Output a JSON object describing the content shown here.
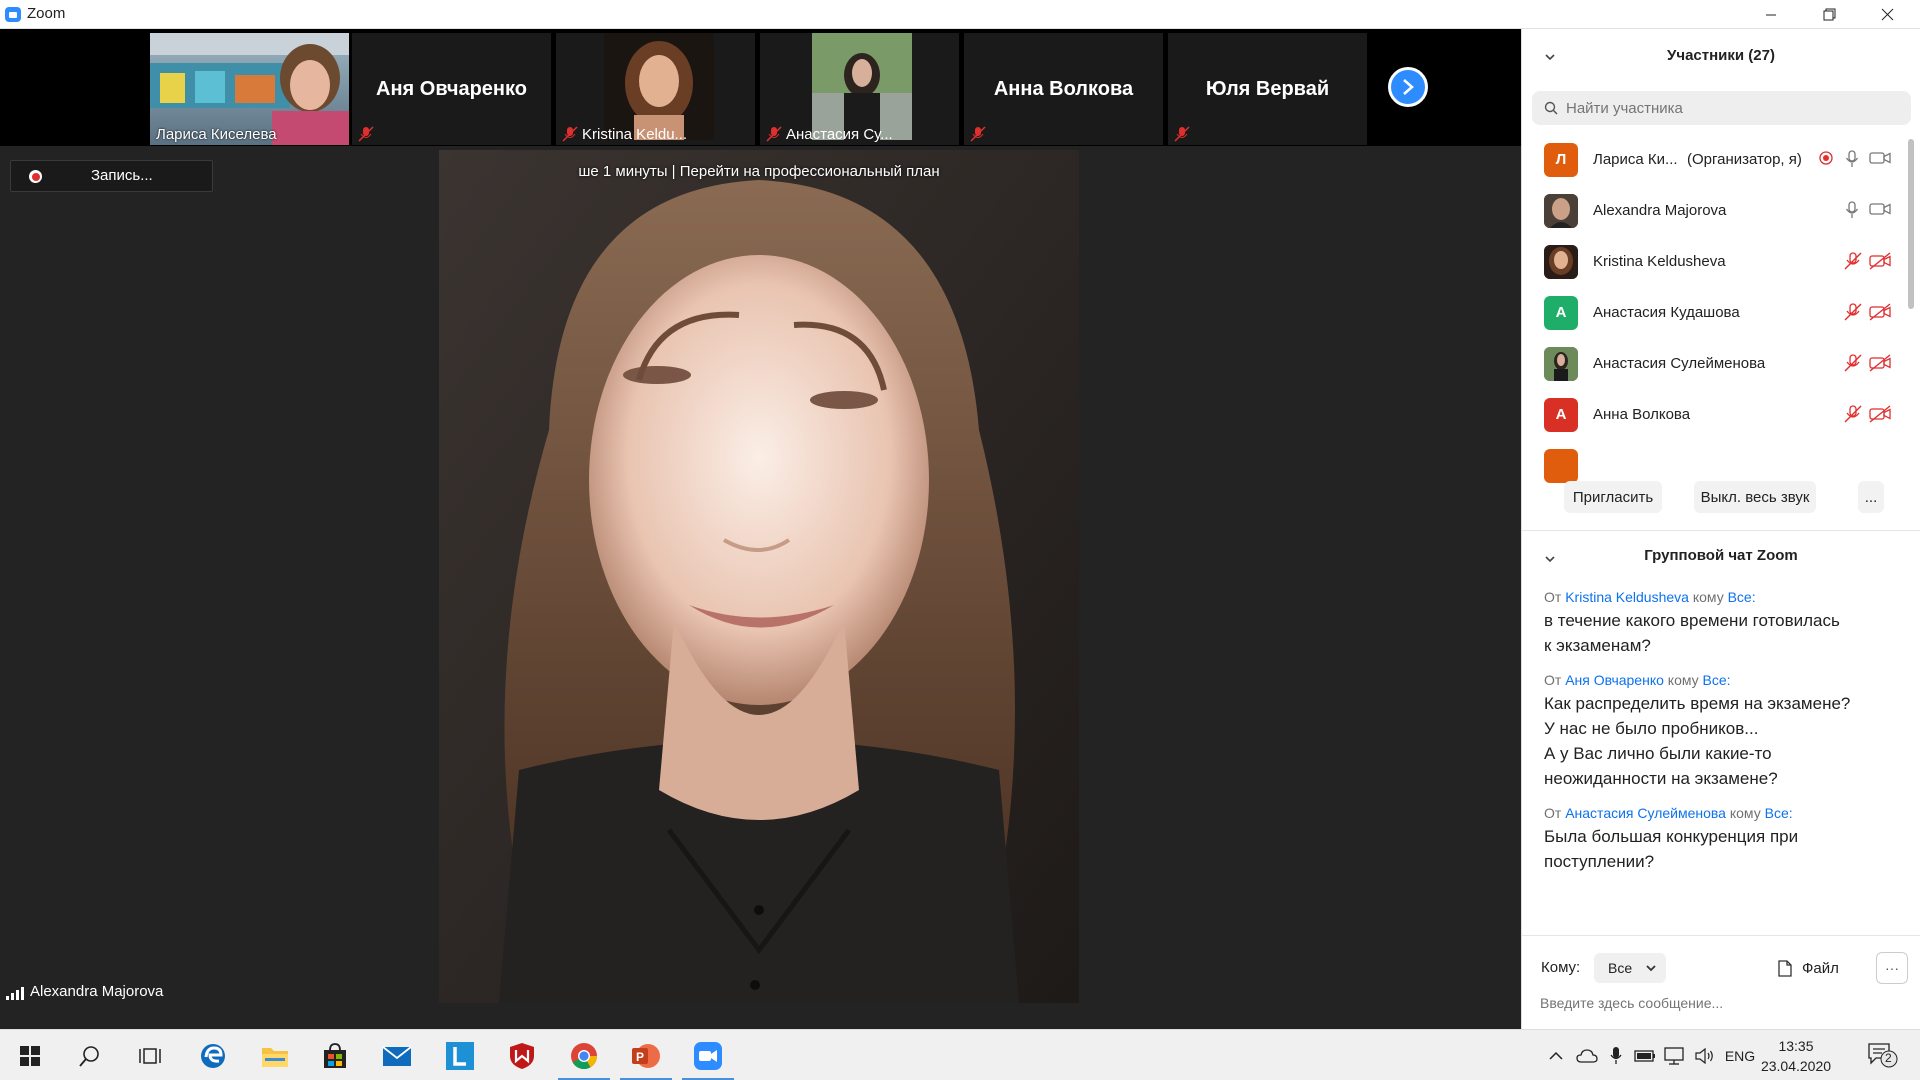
{
  "window": {
    "title": "Zoom"
  },
  "strip": {
    "tiles": [
      {
        "label": "Лариса Киселева"
      },
      {
        "name": "Аня Овчаренко"
      },
      {
        "label": "Kristina Keldu..."
      },
      {
        "label": "Анастасия Су..."
      },
      {
        "name": "Анна Волкова"
      },
      {
        "name": "Юля Вервай"
      }
    ]
  },
  "recording": {
    "label": "Запись..."
  },
  "main_video": {
    "banner": "ше 1 минуты | Перейти на профессиональный план",
    "speaker": "Alexandra Majorova"
  },
  "participants": {
    "title": "Участники (27)",
    "search_placeholder": "Найти участника",
    "list": [
      {
        "initial": "Л",
        "name": "Лариса Ки...",
        "role": "(Организатор, я)",
        "color": "#e05d0e"
      },
      {
        "initial": "",
        "name": "Alexandra Majorova",
        "role": "",
        "color": "#4a4038"
      },
      {
        "initial": "",
        "name": "Kristina Keldusheva",
        "role": "",
        "color": "#8a5a44"
      },
      {
        "initial": "А",
        "name": "Анастасия Кудашова",
        "role": "",
        "color": "#1fae6a"
      },
      {
        "initial": "",
        "name": "Анастасия Сулейменова",
        "role": "",
        "color": "#55604a"
      },
      {
        "initial": "А",
        "name": "Анна Волкова",
        "role": "",
        "color": "#d93025"
      }
    ],
    "invite_label": "Пригласить",
    "mute_all_label": "Выкл. весь звук",
    "more_label": "..."
  },
  "chat": {
    "title": "Групповой чат Zoom",
    "from_word": "От",
    "to_word": "кому",
    "messages": [
      {
        "from": "Kristina Keldusheva",
        "to": "Все:",
        "lines": [
          "в течение какого времени готовилась",
          "к экзаменам?"
        ]
      },
      {
        "from": "Аня Овчаренко",
        "to": "Все:",
        "lines": [
          "Как распределить время на экзамене?",
          "У нас не было пробников...",
          "А у Вас лично были какие-то",
          "неожиданности на экзамене?"
        ]
      },
      {
        "from": "Анастасия Сулейменова",
        "to": "Все:",
        "lines": [
          "Была большая конкуренция при",
          "поступлении?"
        ]
      }
    ],
    "to_label": "Кому:",
    "to_value": "Все",
    "file_label": "Файл",
    "more_label": "···",
    "input_placeholder": "Введите здесь сообщение..."
  },
  "taskbar": {
    "lang": "ENG",
    "time": "13:35",
    "date": "23.04.2020",
    "notifications": "2"
  },
  "colors": {
    "accent": "#2d8cff",
    "muted_red": "#e02f2f",
    "chat_name": "#0e72ed"
  }
}
